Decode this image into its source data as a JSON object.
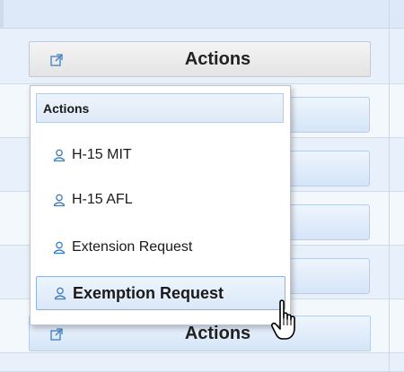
{
  "grid": {
    "actions_label": "Actions"
  },
  "dropdown": {
    "header": "Actions",
    "items": [
      {
        "label": "H-15 MIT",
        "icon": "user-icon"
      },
      {
        "label": "H-15 AFL",
        "icon": "user-icon"
      },
      {
        "label": "Extension Request",
        "icon": "user-icon"
      },
      {
        "label": "Exemption Request",
        "icon": "user-icon",
        "hovered": true
      }
    ]
  },
  "colors": {
    "accent_border": "#8fb2da",
    "icon_blue": "#3f7fc4",
    "grid_band": "#dde9f8"
  }
}
